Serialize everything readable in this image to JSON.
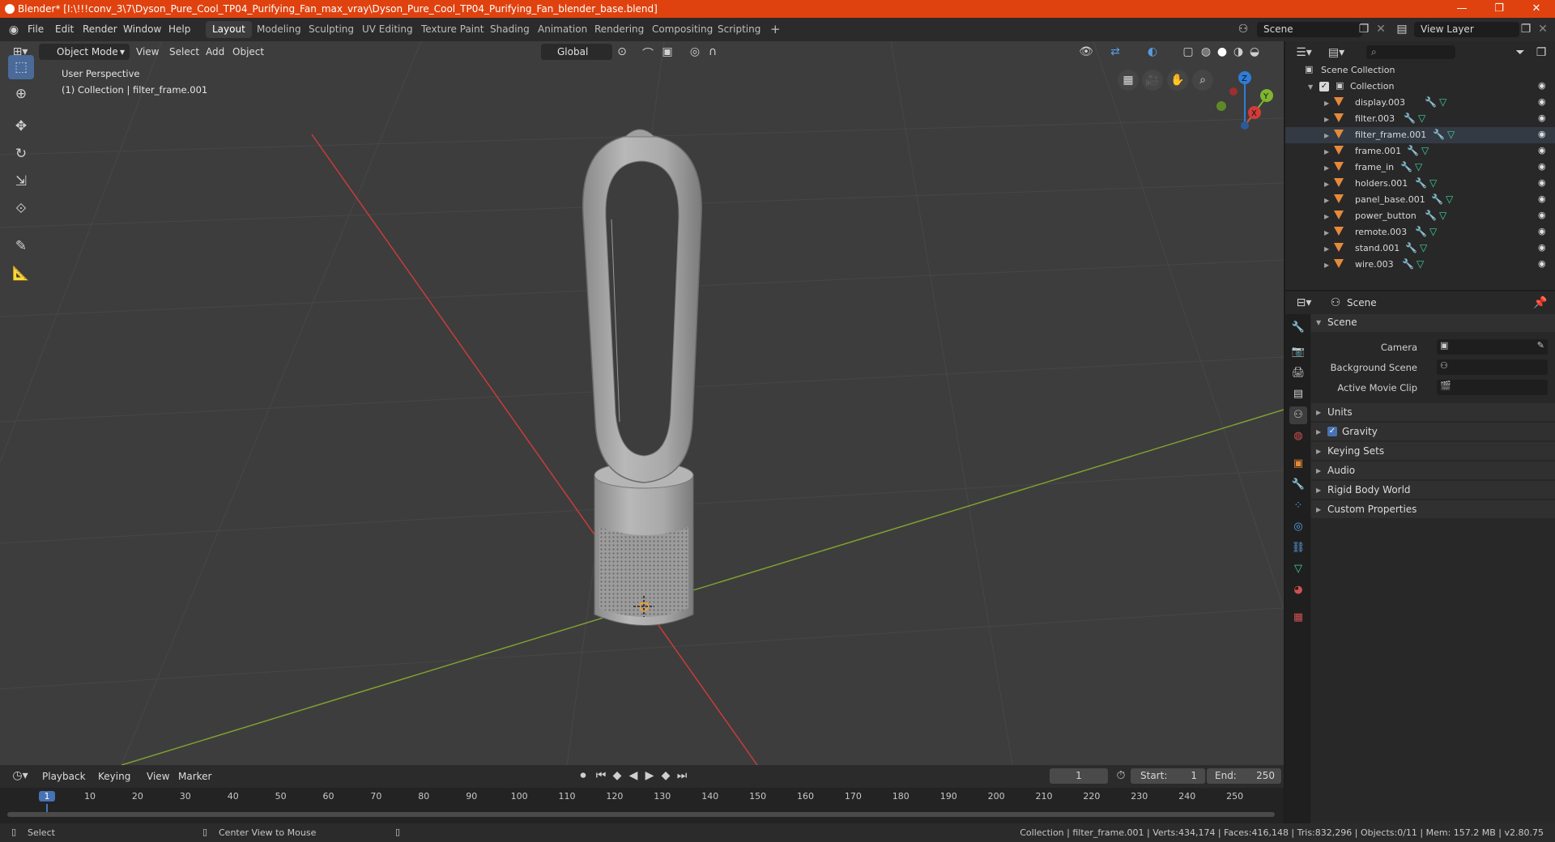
{
  "window": {
    "title": "Blender* [I:\\!!!conv_3\\7\\Dyson_Pure_Cool_TP04_Purifying_Fan_max_vray\\Dyson_Pure_Cool_TP04_Purifying_Fan_blender_base.blend]",
    "controls": {
      "minimize": "—",
      "restore": "❐",
      "close": "✕"
    }
  },
  "menu": [
    "File",
    "Edit",
    "Render",
    "Window",
    "Help"
  ],
  "workspaces": [
    "Layout",
    "Modeling",
    "Sculpting",
    "UV Editing",
    "Texture Paint",
    "Shading",
    "Animation",
    "Rendering",
    "Compositing",
    "Scripting"
  ],
  "active_workspace": "Layout",
  "add_workspace": "+",
  "scene_field": "Scene",
  "view_layer_field": "View Layer",
  "viewport": {
    "mode": "Object Mode",
    "menus": [
      "View",
      "Select",
      "Add",
      "Object"
    ],
    "transform_orientation": "Global",
    "overlay_title": "User Perspective",
    "overlay_subtitle": "(1) Collection | filter_frame.001",
    "gizmo_labels": {
      "z": "Z",
      "y": "Y",
      "x": "X"
    }
  },
  "outliner": {
    "search_placeholder": "",
    "root": "Scene Collection",
    "collection": "Collection",
    "objects": [
      "display.003",
      "filter.003",
      "filter_frame.001",
      "frame.001",
      "frame_in",
      "holders.001",
      "panel_base.001",
      "power_button",
      "remote.003",
      "stand.001",
      "wire.003"
    ],
    "selected": "filter_frame.001"
  },
  "properties": {
    "context": "Scene",
    "panel_title": "Scene",
    "fields": [
      {
        "label": "Camera",
        "value": ""
      },
      {
        "label": "Background Scene",
        "value": ""
      },
      {
        "label": "Active Movie Clip",
        "value": ""
      }
    ],
    "sections": [
      "Units",
      "Gravity",
      "Keying Sets",
      "Audio",
      "Rigid Body World",
      "Custom Properties"
    ],
    "gravity_checked": true
  },
  "timeline": {
    "menus": [
      "Playback",
      "Keying",
      "View",
      "Marker"
    ],
    "current_frame": "1",
    "start_label": "Start:",
    "start": "1",
    "end_label": "End:",
    "end": "250",
    "ruler": [
      "1",
      "10",
      "20",
      "30",
      "40",
      "50",
      "60",
      "70",
      "80",
      "90",
      "100",
      "110",
      "120",
      "130",
      "140",
      "150",
      "160",
      "170",
      "180",
      "190",
      "200",
      "210",
      "220",
      "230",
      "240",
      "250"
    ]
  },
  "statusbar": {
    "left_action": "Select",
    "middle_action": "Center View to Mouse",
    "stats": "Collection | filter_frame.001 | Verts:434,174 | Faces:416,148 | Tris:832,296 | Objects:0/11 | Mem: 157.2 MB | v2.80.75"
  },
  "colors": {
    "titlebar": "#e0420f",
    "viewport_bg": "#3d3d3d",
    "axis_x": "#c83c3c",
    "axis_y": "#7fa030",
    "selection_blue": "#4772b3",
    "mesh_orange": "#e48a3a"
  }
}
